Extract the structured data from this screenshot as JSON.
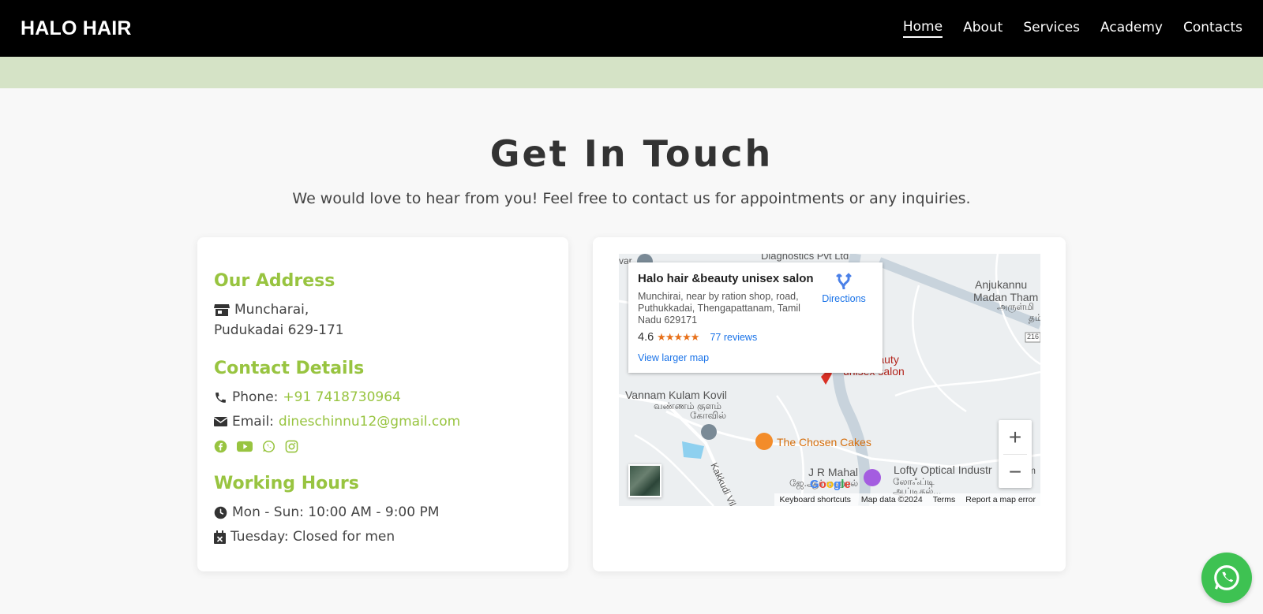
{
  "nav": {
    "brand": "HALO HAIR",
    "links": [
      {
        "label": "Home",
        "active": true
      },
      {
        "label": "About"
      },
      {
        "label": "Services"
      },
      {
        "label": "Academy"
      },
      {
        "label": "Contacts"
      }
    ]
  },
  "hero": {
    "title": "Get In Touch",
    "subtitle": "We would love to hear from you! Feel free to contact us for appointments or any inquiries."
  },
  "contact": {
    "address_title": "Our Address",
    "address_line1": "Muncharai,",
    "address_line2": "Pudukadai 629-171",
    "details_title": "Contact Details",
    "phone_label": "Phone:",
    "phone_value": "+91 7418730964",
    "email_label": "Email:",
    "email_value": "dineschinnu12@gmail.com",
    "socials": [
      "facebook-icon",
      "youtube-icon",
      "whatsapp-icon",
      "instagram-icon"
    ],
    "hours_title": "Working Hours",
    "hours_line1": "Mon - Sun: 10:00 AM - 9:00 PM",
    "hours_line2": "Tuesday: Closed for men"
  },
  "map": {
    "place_name": "Halo hair &beauty unisex salon",
    "address": "Munchirai, near by ration shop, road, Puthukkadai, Thengapattanam, Tamil Nadu 629171",
    "rating": "4.6",
    "stars": "★★★★★",
    "reviews": "77 reviews",
    "larger_map": "View larger map",
    "directions": "Directions",
    "labels": {
      "diagnostics": "Diagnostics Pvt Ltd",
      "anjukannu": "Anjukannu",
      "madan": "Madan Tham",
      "tamil_temple": "அருள்மி",
      "tamil_temple2": "தம்",
      "road_216": "216",
      "marker_a": "air &beauty",
      "marker_b": "unisex salon",
      "vannam": "Vannam Kulam Kovil",
      "vannam_t1": "வண்ணம் குளம்",
      "vannam_t2": "கோவில்",
      "cakes": "The Chosen Cakes",
      "jr_mahal": "J R Mahal",
      "jr_tamil": "ஜே.ஆர் மஹால்",
      "lofty": "Lofty Optical Industr",
      "lofty_t1": "லோஃப்டி",
      "lofty_t2": "ஆப்டிகல்...",
      "kakkudi": "Kakkudi Vilai",
      "var": "var",
      "ym": "ym",
      "google": "Google"
    },
    "attribution": [
      "Keyboard shortcuts",
      "Map data ©2024",
      "Terms",
      "Report a map error"
    ],
    "zoom_in": "+",
    "zoom_out": "−"
  },
  "colors": {
    "accent": "#98c440",
    "navbar": "#000000",
    "band": "#d5e3c6",
    "whatsapp": "#3ec252",
    "link_blue": "#1a73e8"
  }
}
